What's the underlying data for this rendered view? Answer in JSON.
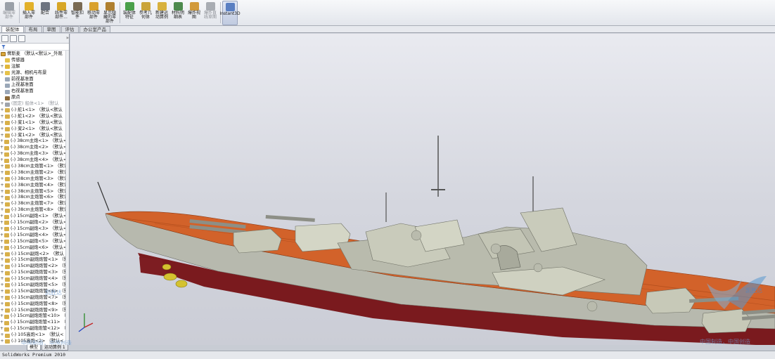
{
  "toolbar": {
    "buttons": [
      {
        "label": "编辑零部件",
        "icon": "edit-component-icon",
        "disabled": true,
        "color": "#9aa0a8"
      },
      {
        "label": "插入零部件",
        "icon": "insert-component-icon",
        "disabled": false,
        "color": "#e2b12b"
      },
      {
        "label": "配合",
        "icon": "mate-icon",
        "disabled": false,
        "color": "#6c7380"
      },
      {
        "label": "线性零部件...",
        "icon": "linear-pattern-icon",
        "disabled": false,
        "color": "#d7a626"
      },
      {
        "label": "智能扣件",
        "icon": "smart-fastener-icon",
        "disabled": false,
        "color": "#7a6a52"
      },
      {
        "label": "移动零部件",
        "icon": "move-component-icon",
        "disabled": false,
        "color": "#d9a12e"
      },
      {
        "label": "显示隐藏的零部件",
        "icon": "show-hidden-icon",
        "disabled": false,
        "color": "#b0802f"
      },
      {
        "label": "装配体特征",
        "icon": "assembly-feature-icon",
        "disabled": false,
        "color": "#4aa04a"
      },
      {
        "label": "参考几何体",
        "icon": "reference-geometry-icon",
        "disabled": false,
        "color": "#caa43a"
      },
      {
        "label": "新建运动算例",
        "icon": "motion-study-icon",
        "disabled": false,
        "color": "#d8b13c"
      },
      {
        "label": "材料明细表",
        "icon": "bom-icon",
        "disabled": false,
        "color": "#4d8a4d"
      },
      {
        "label": "爆炸视图",
        "icon": "exploded-view-icon",
        "disabled": false,
        "color": "#d29a3a"
      },
      {
        "label": "爆炸直线草图",
        "icon": "explode-line-icon",
        "disabled": true,
        "color": "#a9adb3"
      },
      {
        "label": "Instant3D",
        "icon": "instant3d-icon",
        "disabled": false,
        "color": "#5a7fc2",
        "active": true
      }
    ]
  },
  "tabs": [
    "装配体",
    "布局",
    "草图",
    "评估",
    "办公室产品"
  ],
  "selected_tab": "装配体",
  "feature_tree": {
    "root": "俾斯麦 （默认<默认>_外观",
    "items": [
      {
        "label": "传感器",
        "icon": "sensor-folder-icon",
        "color": "#e6c24a",
        "dim": false
      },
      {
        "label": "注解",
        "icon": "annotations-icon",
        "color": "#e1b73a",
        "dim": false
      },
      {
        "label": "光源、相机与布景",
        "icon": "lights-cameras-icon",
        "color": "#e6c24a",
        "dim": false
      },
      {
        "label": "前视基准面",
        "icon": "plane-icon",
        "color": "#9aa7b8",
        "dim": false
      },
      {
        "label": "上视基准面",
        "icon": "plane-icon",
        "color": "#9aa7b8",
        "dim": false
      },
      {
        "label": "右视基准面",
        "icon": "plane-icon",
        "color": "#9aa7b8",
        "dim": false
      },
      {
        "label": "原点",
        "icon": "origin-icon",
        "color": "#8d6a3a",
        "dim": false
      },
      {
        "label": "(固定) 船体<1> （默认",
        "icon": "part-icon",
        "color": "#9fa4ab",
        "dim": true
      },
      {
        "label": "(-) 舵1<1> （默认<默认",
        "icon": "part-icon",
        "color": "#d8b04a",
        "dim": false
      },
      {
        "label": "(-) 舵1<2> （默认<默认",
        "icon": "part-icon",
        "color": "#d8b04a",
        "dim": false
      },
      {
        "label": "(-) 桨1<1> （默认<默认",
        "icon": "part-icon",
        "color": "#d8b04a",
        "dim": false
      },
      {
        "label": "(-) 桨2<1> （默认<默认",
        "icon": "part-icon",
        "color": "#d8b04a",
        "dim": false
      },
      {
        "label": "(-) 桨1<2> （默认<默认",
        "icon": "part-icon",
        "color": "#d8b04a",
        "dim": false
      },
      {
        "label": "(-) 38cm主炮<1> （默认<<",
        "icon": "part-icon",
        "color": "#d8b04a",
        "dim": false
      },
      {
        "label": "(-) 38cm主炮<2> （默认<<",
        "icon": "part-icon",
        "color": "#d8b04a",
        "dim": false
      },
      {
        "label": "(-) 38cm主炮<3> （默认<<",
        "icon": "part-icon",
        "color": "#d8b04a",
        "dim": false
      },
      {
        "label": "(-) 38cm主炮<4> （默认<<",
        "icon": "part-icon",
        "color": "#d8b04a",
        "dim": false
      },
      {
        "label": "(-) 38cm主炮管<1> （默认",
        "icon": "part-icon",
        "color": "#d8b04a",
        "dim": false
      },
      {
        "label": "(-) 38cm主炮管<2> （默认",
        "icon": "part-icon",
        "color": "#d8b04a",
        "dim": false
      },
      {
        "label": "(-) 38cm主炮管<3> （默认",
        "icon": "part-icon",
        "color": "#d8b04a",
        "dim": false
      },
      {
        "label": "(-) 38cm主炮管<4> （默认",
        "icon": "part-icon",
        "color": "#d8b04a",
        "dim": false
      },
      {
        "label": "(-) 38cm主炮管<5> （默认",
        "icon": "part-icon",
        "color": "#d8b04a",
        "dim": false
      },
      {
        "label": "(-) 38cm主炮管<6> （默认",
        "icon": "part-icon",
        "color": "#d8b04a",
        "dim": false
      },
      {
        "label": "(-) 38cm主炮管<7> （默认",
        "icon": "part-icon",
        "color": "#d8b04a",
        "dim": false
      },
      {
        "label": "(-) 38cm主炮管<8> （默认",
        "icon": "part-icon",
        "color": "#d8b04a",
        "dim": false
      },
      {
        "label": "(-) 15cm副炮<1> （默认<<",
        "icon": "part-icon",
        "color": "#d8b04a",
        "dim": false
      },
      {
        "label": "(-) 15cm副炮<2> （默认<<",
        "icon": "part-icon",
        "color": "#d8b04a",
        "dim": false
      },
      {
        "label": "(-) 15cm副炮<3> （默认<<",
        "icon": "part-icon",
        "color": "#d8b04a",
        "dim": false
      },
      {
        "label": "(-) 15cm副炮<4> （默认<<",
        "icon": "part-icon",
        "color": "#d8b04a",
        "dim": false
      },
      {
        "label": "(-) 15cm副炮<5> （默认<<",
        "icon": "part-icon",
        "color": "#d8b04a",
        "dim": false
      },
      {
        "label": "(-) 15cm副炮<6> （默认<<",
        "icon": "part-icon",
        "color": "#d8b04a",
        "dim": false
      },
      {
        "label": "(-) 15cm副炮<2> （默认",
        "icon": "part-icon",
        "color": "#d8b04a",
        "dim": false
      },
      {
        "label": "(-) 15cm副炮炮管<1> （默",
        "icon": "part-icon",
        "color": "#d8b04a",
        "dim": false
      },
      {
        "label": "(-) 15cm副炮炮管<2> （默",
        "icon": "part-icon",
        "color": "#d8b04a",
        "dim": false
      },
      {
        "label": "(-) 15cm副炮炮管<3> （默",
        "icon": "part-icon",
        "color": "#d8b04a",
        "dim": false
      },
      {
        "label": "(-) 15cm副炮炮管<4> （默",
        "icon": "part-icon",
        "color": "#d8b04a",
        "dim": false
      },
      {
        "label": "(-) 15cm副炮炮管<5> （默",
        "icon": "part-icon",
        "color": "#d8b04a",
        "dim": false
      },
      {
        "label": "(-) 15cm副炮炮管<6> （默",
        "icon": "part-icon",
        "color": "#d8b04a",
        "dim": false
      },
      {
        "label": "(-) 15cm副炮炮管<7> （默",
        "icon": "part-icon",
        "color": "#d8b04a",
        "dim": false
      },
      {
        "label": "(-) 15cm副炮炮管<8> （默",
        "icon": "part-icon",
        "color": "#d8b04a",
        "dim": false
      },
      {
        "label": "(-) 15cm副炮炮管<9> （默",
        "icon": "part-icon",
        "color": "#d8b04a",
        "dim": false
      },
      {
        "label": "(-) 15cm副炮炮管<10> （默",
        "icon": "part-icon",
        "color": "#d8b04a",
        "dim": false
      },
      {
        "label": "(-) 15cm副炮炮管<11> （默",
        "icon": "part-icon",
        "color": "#d8b04a",
        "dim": false
      },
      {
        "label": "(-) 15cm副炮炮管<12> （默",
        "icon": "part-icon",
        "color": "#d8b04a",
        "dim": false
      },
      {
        "label": "(-) 105高炮<1> （默认<",
        "icon": "part-icon",
        "color": "#d8b04a",
        "dim": false
      },
      {
        "label": "(-) 105高炮<2> （默认<",
        "icon": "part-icon",
        "color": "#d8b04a",
        "dim": false
      }
    ]
  },
  "bottom_tabs": [
    "模型",
    "运动算例 1"
  ],
  "status": {
    "text": "SolidWorks Premium 2010"
  },
  "watermark": {
    "brand": "凯胜达",
    "text_left": "中国制造，中国创造",
    "text_right": "中国制造，中国创造"
  },
  "heads_up_icons": [
    "zoom-to-fit-icon",
    "zoom-area-icon",
    "previous-view-icon",
    "section-view-icon",
    "view-orientation-icon",
    "display-style-icon",
    "hide-show-icon",
    "edit-appearance-icon",
    "apply-scene-icon",
    "view-settings-icon"
  ],
  "colors": {
    "deck": "#d2622a",
    "hull": "#b7b9ae",
    "hull_lower": "#7a1a1e",
    "superstructure": "#c7c9b8",
    "propeller": "#d4c230",
    "viewport_bg": "#dcdde4"
  }
}
